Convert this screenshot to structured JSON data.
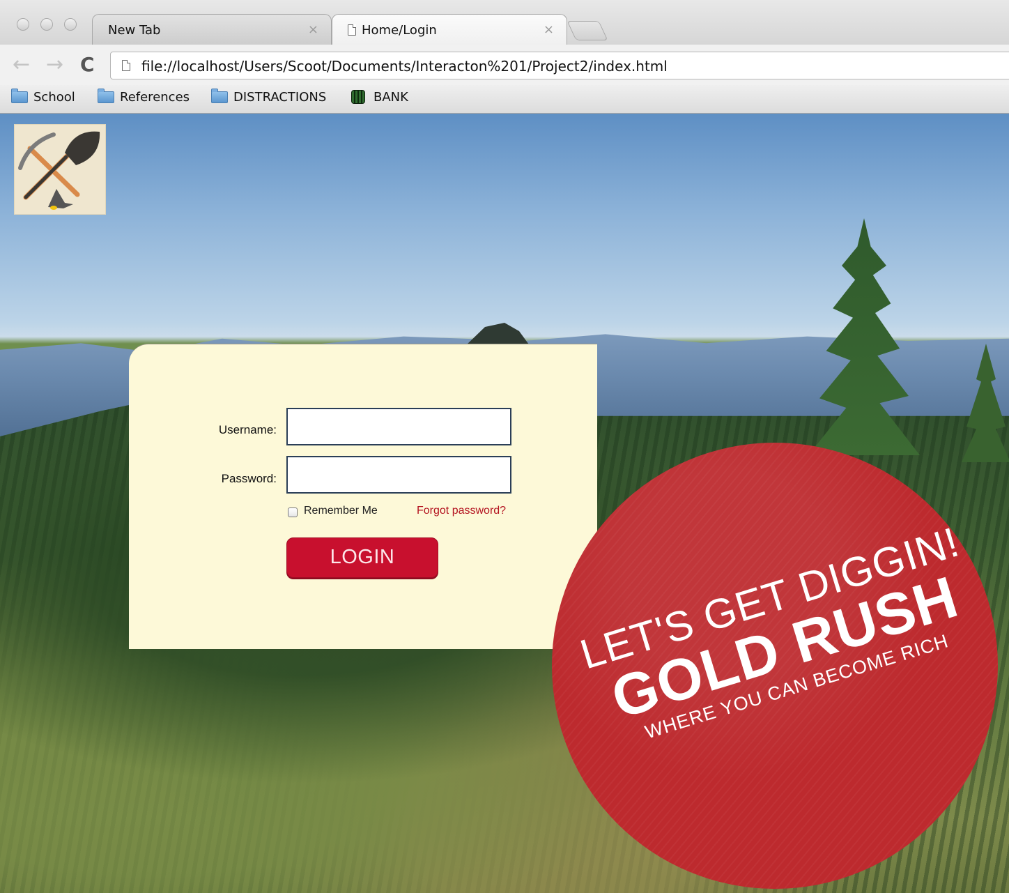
{
  "browser": {
    "tabs": [
      {
        "label": "New Tab",
        "active": false
      },
      {
        "label": "Home/Login",
        "active": true
      }
    ],
    "close_glyph": "×",
    "address": "file://localhost/Users/Scoot/Documents/Interacton%201/Project2/index.html",
    "nav": {
      "back": "←",
      "forward": "→",
      "reload": "C"
    },
    "bookmarks": [
      {
        "label": "School",
        "icon": "folder-icon"
      },
      {
        "label": "References",
        "icon": "folder-icon"
      },
      {
        "label": "DISTRACTIONS",
        "icon": "folder-icon"
      },
      {
        "label": "BANK",
        "icon": "bank-favicon-icon"
      }
    ]
  },
  "page": {
    "logo_icon": "pickaxe-shovel-logo-icon",
    "login": {
      "username_label": "Username:",
      "password_label": "Password:",
      "remember_label": "Remember Me",
      "forgot_label": "Forgot password?",
      "button_label": "LOGIN",
      "username_value": "",
      "password_value": ""
    },
    "badge": {
      "line1": "LET'S GET DIGGIN!",
      "line2": "GOLD RUSH",
      "line3": "WHERE YOU CAN BECOME RICH"
    },
    "colors": {
      "accent": "#c8102e",
      "panel": "#fdf9d8",
      "badge": "#bd2a2e",
      "link": "#b3121f"
    }
  }
}
